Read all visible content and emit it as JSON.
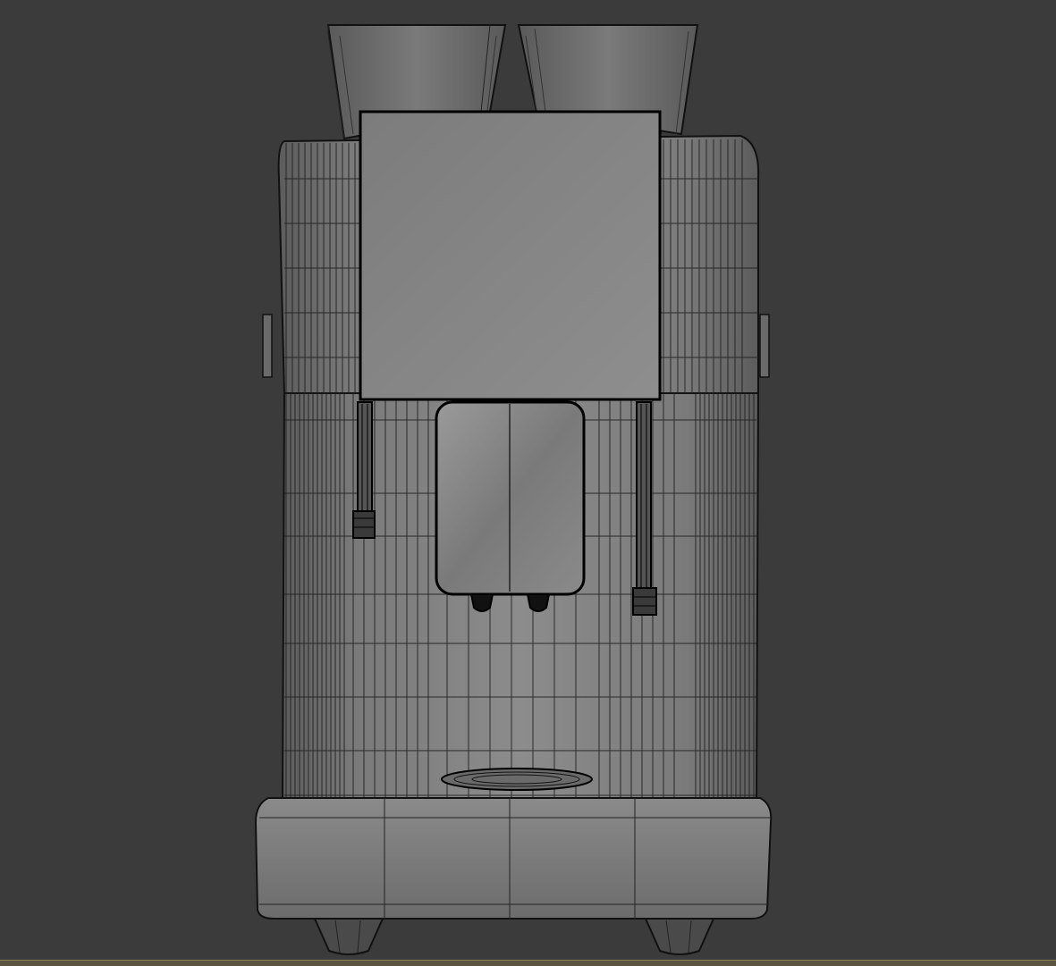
{
  "scene": {
    "background_color": "#3b3b3b",
    "subject": "coffee-machine-wireframe",
    "render_style": "shaded-with-wireframe",
    "wire_color": "#1a1a1a",
    "surface_color": "#8a8a8a",
    "hopper_count": 2,
    "steam_wand_count": 2,
    "spout_count": 2,
    "foot_count": 2
  }
}
